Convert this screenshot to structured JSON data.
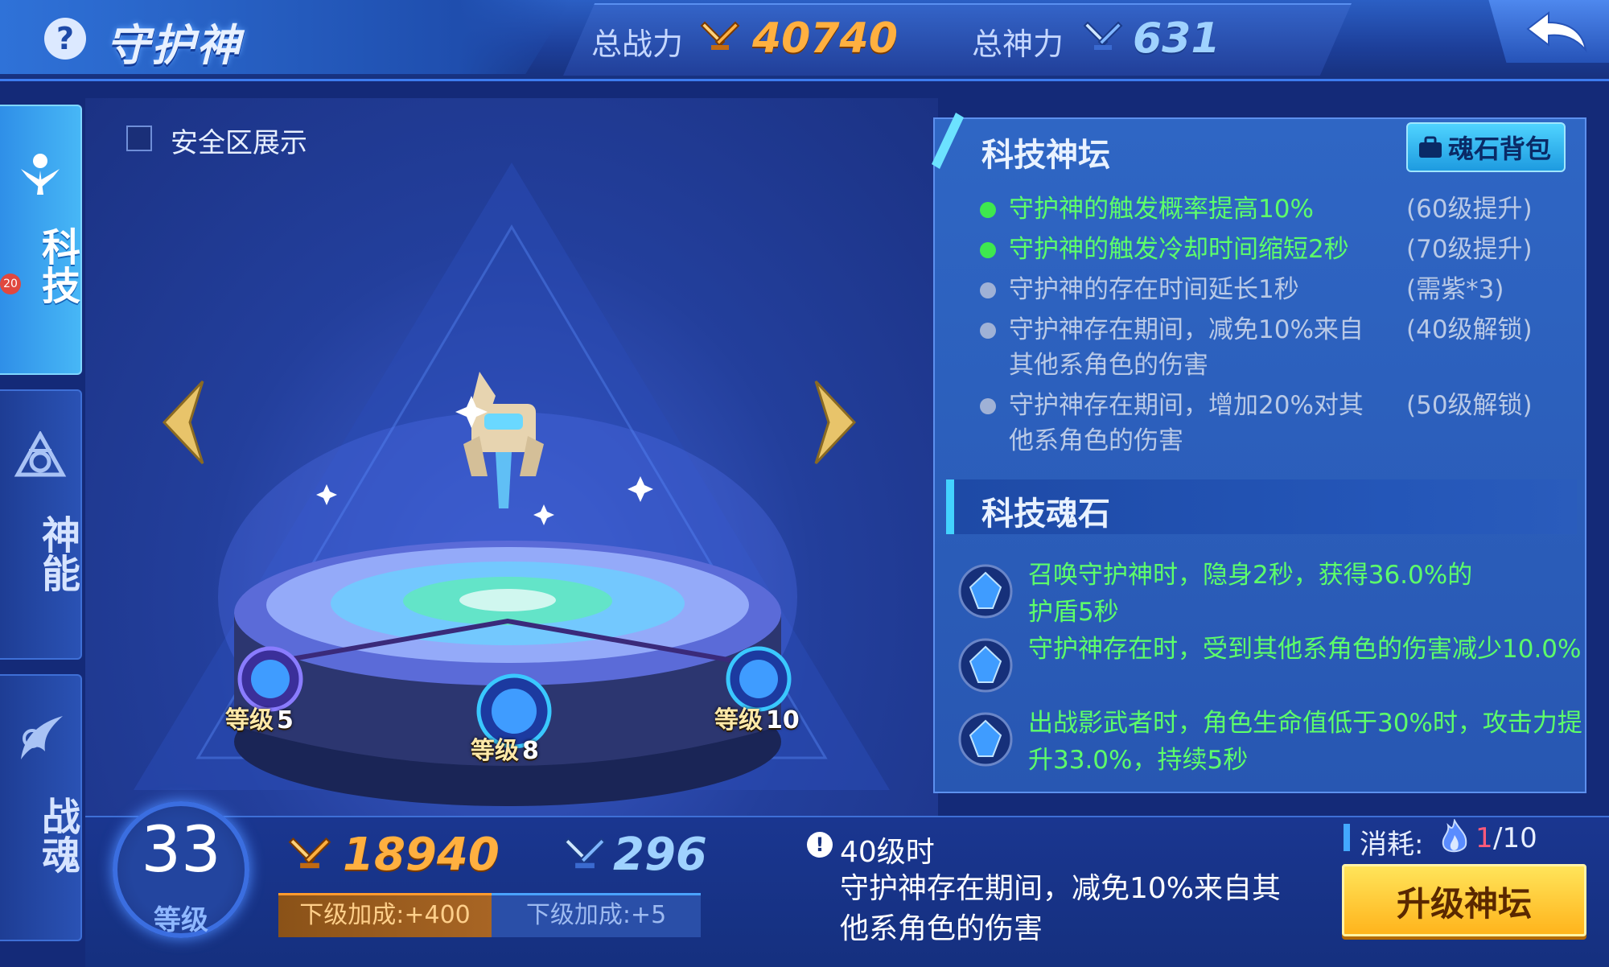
{
  "header": {
    "title": "守护神",
    "total_power_label": "总战力",
    "total_power_value": "40740",
    "total_divine_label": "总神力",
    "total_divine_value": "631"
  },
  "nav": {
    "items": [
      {
        "label": "科技",
        "icon": "tech-icon",
        "active": true
      },
      {
        "label": "神能",
        "icon": "divine-energy-icon",
        "active": false
      },
      {
        "label": "战魂",
        "icon": "battle-soul-icon",
        "active": false
      }
    ],
    "badge": "20"
  },
  "stage": {
    "safe_zone_label": "安全区展示",
    "safe_zone_checked": false,
    "sockets": [
      {
        "tag": "等级",
        "level": "5"
      },
      {
        "tag": "等级",
        "level": "8"
      },
      {
        "tag": "等级",
        "level": "10"
      }
    ]
  },
  "altar": {
    "title": "科技神坛",
    "bag_button": "魂石背包",
    "effects": [
      {
        "text": "守护神的触发概率提高10%",
        "condition": "(60级提升)",
        "active": true
      },
      {
        "text": "守护神的触发冷却时间缩短2秒",
        "condition": "(70级提升)",
        "active": true
      },
      {
        "text": "守护神的存在时间延长1秒",
        "condition": "(需紫*3)",
        "active": false
      },
      {
        "text": "守护神存在期间，减免10%来自其他系角色的伤害",
        "condition": "(40级解锁)",
        "active": false
      },
      {
        "text": "守护神存在期间，增加20%对其他系角色的伤害",
        "condition": "(50级解锁)",
        "active": false
      }
    ]
  },
  "soulstones": {
    "title": "科技魂石",
    "items": [
      {
        "text": "召唤守护神时，隐身2秒，获得36.0%的护盾5秒"
      },
      {
        "text": "守护神存在时，受到其他系角色的伤害减少10.0%"
      },
      {
        "text": "出战影武者时，角色生命值低于30%时，攻击力提升33.0%，持续5秒"
      }
    ]
  },
  "bottom": {
    "level": "33",
    "level_label": "等级",
    "power_value": "18940",
    "divine_value": "296",
    "next_power_bonus": "下级加成:+400",
    "next_divine_bonus": "下级加成:+5",
    "next_level": "40级时",
    "next_desc": "守护神存在期间，减免10%来自其他系角色的伤害",
    "cost_label": "消耗:",
    "cost_have": "1",
    "cost_total": "/10",
    "upgrade_button": "升级神坛"
  },
  "colors": {
    "accent_gold": "#ffb040",
    "accent_blue": "#9fd2ff",
    "active_green": "#5dff6a",
    "inactive_gray": "#b9c9e6",
    "upgrade_yellow": "#ffd23a"
  }
}
